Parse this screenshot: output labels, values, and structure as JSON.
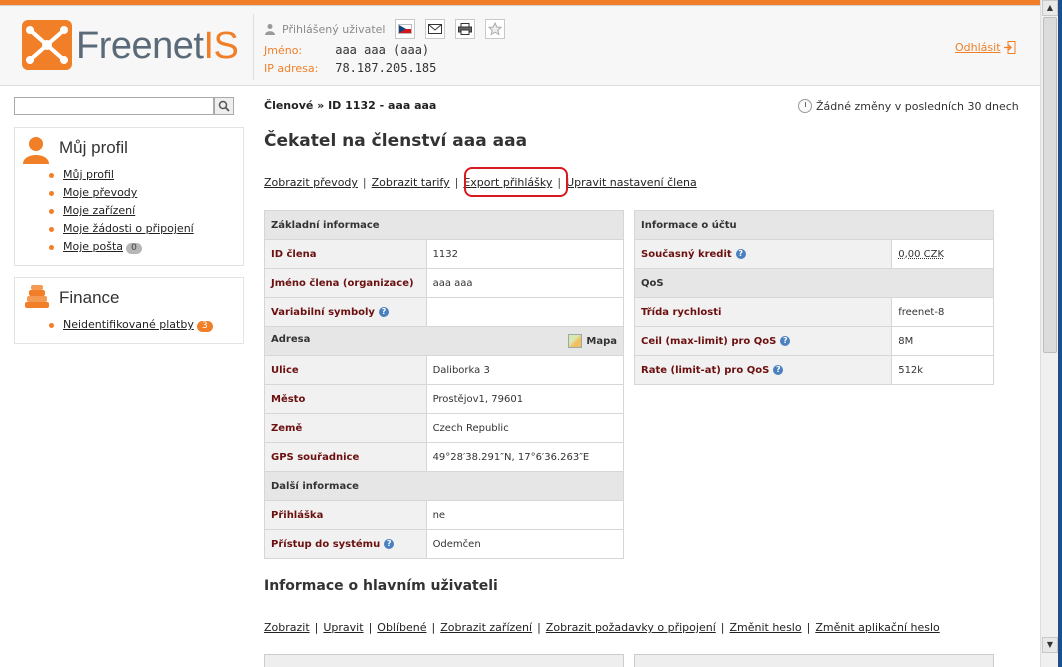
{
  "header": {
    "logo_text_gray": "Freenet",
    "logo_text_orange": "IS",
    "logged_user_label": "Přihlášený uživatel",
    "name_label": "Jméno:",
    "name_value": "aaa aaa (aaa)",
    "ip_label": "IP adresa:",
    "ip_value": "78.187.205.185",
    "logout_label": "Odhlásit"
  },
  "sidebar": {
    "search": {
      "placeholder": ""
    },
    "profile": {
      "title": "Můj profil",
      "items": [
        {
          "label": "Můj profil"
        },
        {
          "label": "Moje převody"
        },
        {
          "label": "Moje zařízení"
        },
        {
          "label": "Moje žádosti o připojení"
        },
        {
          "label": "Moje pošta",
          "badge": "0"
        }
      ]
    },
    "finance": {
      "title": "Finance",
      "items": [
        {
          "label": "Neidentifikované platby",
          "badge": "3"
        }
      ]
    }
  },
  "main": {
    "breadcrumb": "Členové » ID 1132 - aaa aaa",
    "changes": "Žádné změny v posledních 30 dnech",
    "title": "Čekatel na členství aaa aaa",
    "actions": [
      "Zobrazit převody",
      "Zobrazit tarify",
      "Export přihlášky",
      "Upravit nastavení člena"
    ],
    "basic": {
      "section": "Základní informace",
      "rows": [
        {
          "key": "ID člena",
          "value": "1132"
        },
        {
          "key": "Jméno člena (organizace)",
          "value": "aaa aaa"
        },
        {
          "key": "Variabilní symboly",
          "value": ""
        }
      ],
      "address_section": "Adresa",
      "map_label": "Mapa",
      "address_rows": [
        {
          "key": "Ulice",
          "value": "Daliborka 3"
        },
        {
          "key": "Město",
          "value": "Prostějov1, 79601"
        },
        {
          "key": "Země",
          "value": "Czech Republic"
        },
        {
          "key": "GPS souřadnice",
          "value": "49°28′38.291″N, 17°6′36.263″E"
        }
      ],
      "other_section": "Další informace",
      "other_rows": [
        {
          "key": "Přihláška",
          "value": "ne"
        },
        {
          "key": "Přístup do systému",
          "value": "Odemčen"
        }
      ]
    },
    "account": {
      "section": "Informace o účtu",
      "credit_key": "Současný kredit",
      "credit_value": "0,00 CZK",
      "qos_section": "QoS",
      "qos_rows": [
        {
          "key": "Třída rychlosti",
          "value": "freenet-8"
        },
        {
          "key": "Ceil (max-limit) pro QoS",
          "value": "8M"
        },
        {
          "key": "Rate (limit-at) pro QoS",
          "value": "512k"
        }
      ]
    },
    "main_user_title": "Informace o hlavním uživateli",
    "user_actions": [
      "Zobrazit",
      "Upravit",
      "Oblíbené",
      "Zobrazit zařízení",
      "Zobrazit požadavky o připojení",
      "Změnit heslo",
      "Změnit aplikační heslo"
    ]
  },
  "colors": {
    "accent": "#f07f28",
    "label": "#6b0f0f",
    "highlight": "#d71920"
  }
}
